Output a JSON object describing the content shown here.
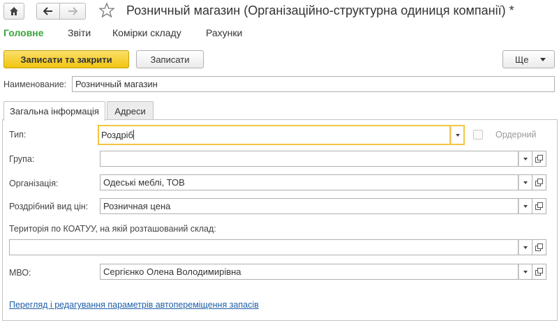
{
  "window": {
    "title": "Розничный магазин (Організаційно-структурна одиниця компанії) *"
  },
  "nav": {
    "home_icon": "home-icon",
    "back_icon": "arrow-left-icon",
    "forward_icon": "arrow-right-icon",
    "favorite_icon": "star-icon"
  },
  "top_tabs": [
    {
      "label": "Головне",
      "active": true
    },
    {
      "label": "Звіти",
      "active": false
    },
    {
      "label": "Комірки складу",
      "active": false
    },
    {
      "label": "Рахунки",
      "active": false
    }
  ],
  "toolbar": {
    "save_close_label": "Записати та закрити",
    "save_label": "Записати",
    "more_label": "Ще"
  },
  "name_field": {
    "label": "Наименование:",
    "value": "Розничный магазин"
  },
  "form_tabs": [
    {
      "label": "Загальна інформація",
      "active": true
    },
    {
      "label": "Адреси",
      "active": false
    }
  ],
  "fields": {
    "type": {
      "label": "Тип:",
      "value": "Роздріб"
    },
    "ordered": {
      "label": "Ордерний",
      "checked": false
    },
    "group": {
      "label": "Група:",
      "value": ""
    },
    "organization": {
      "label": "Організація:",
      "value": "Одеські меблі, ТОВ"
    },
    "price_type": {
      "label": "Роздрібний вид цін:",
      "value": "Розничная цена"
    },
    "koatuu": {
      "label": "Територія по КОАТУУ, на якій розташований склад:",
      "value": ""
    },
    "mvo": {
      "label": "МВО:",
      "value": "Сергієнко Олена Володимирівна"
    }
  },
  "link": {
    "label": "Перегляд і редагування параметрів автопереміщення запасів"
  },
  "colors": {
    "accent_green": "#3aa53a",
    "primary_button": "#f1c40f",
    "focus_border": "#f3c443",
    "link": "#1f5fa8"
  }
}
